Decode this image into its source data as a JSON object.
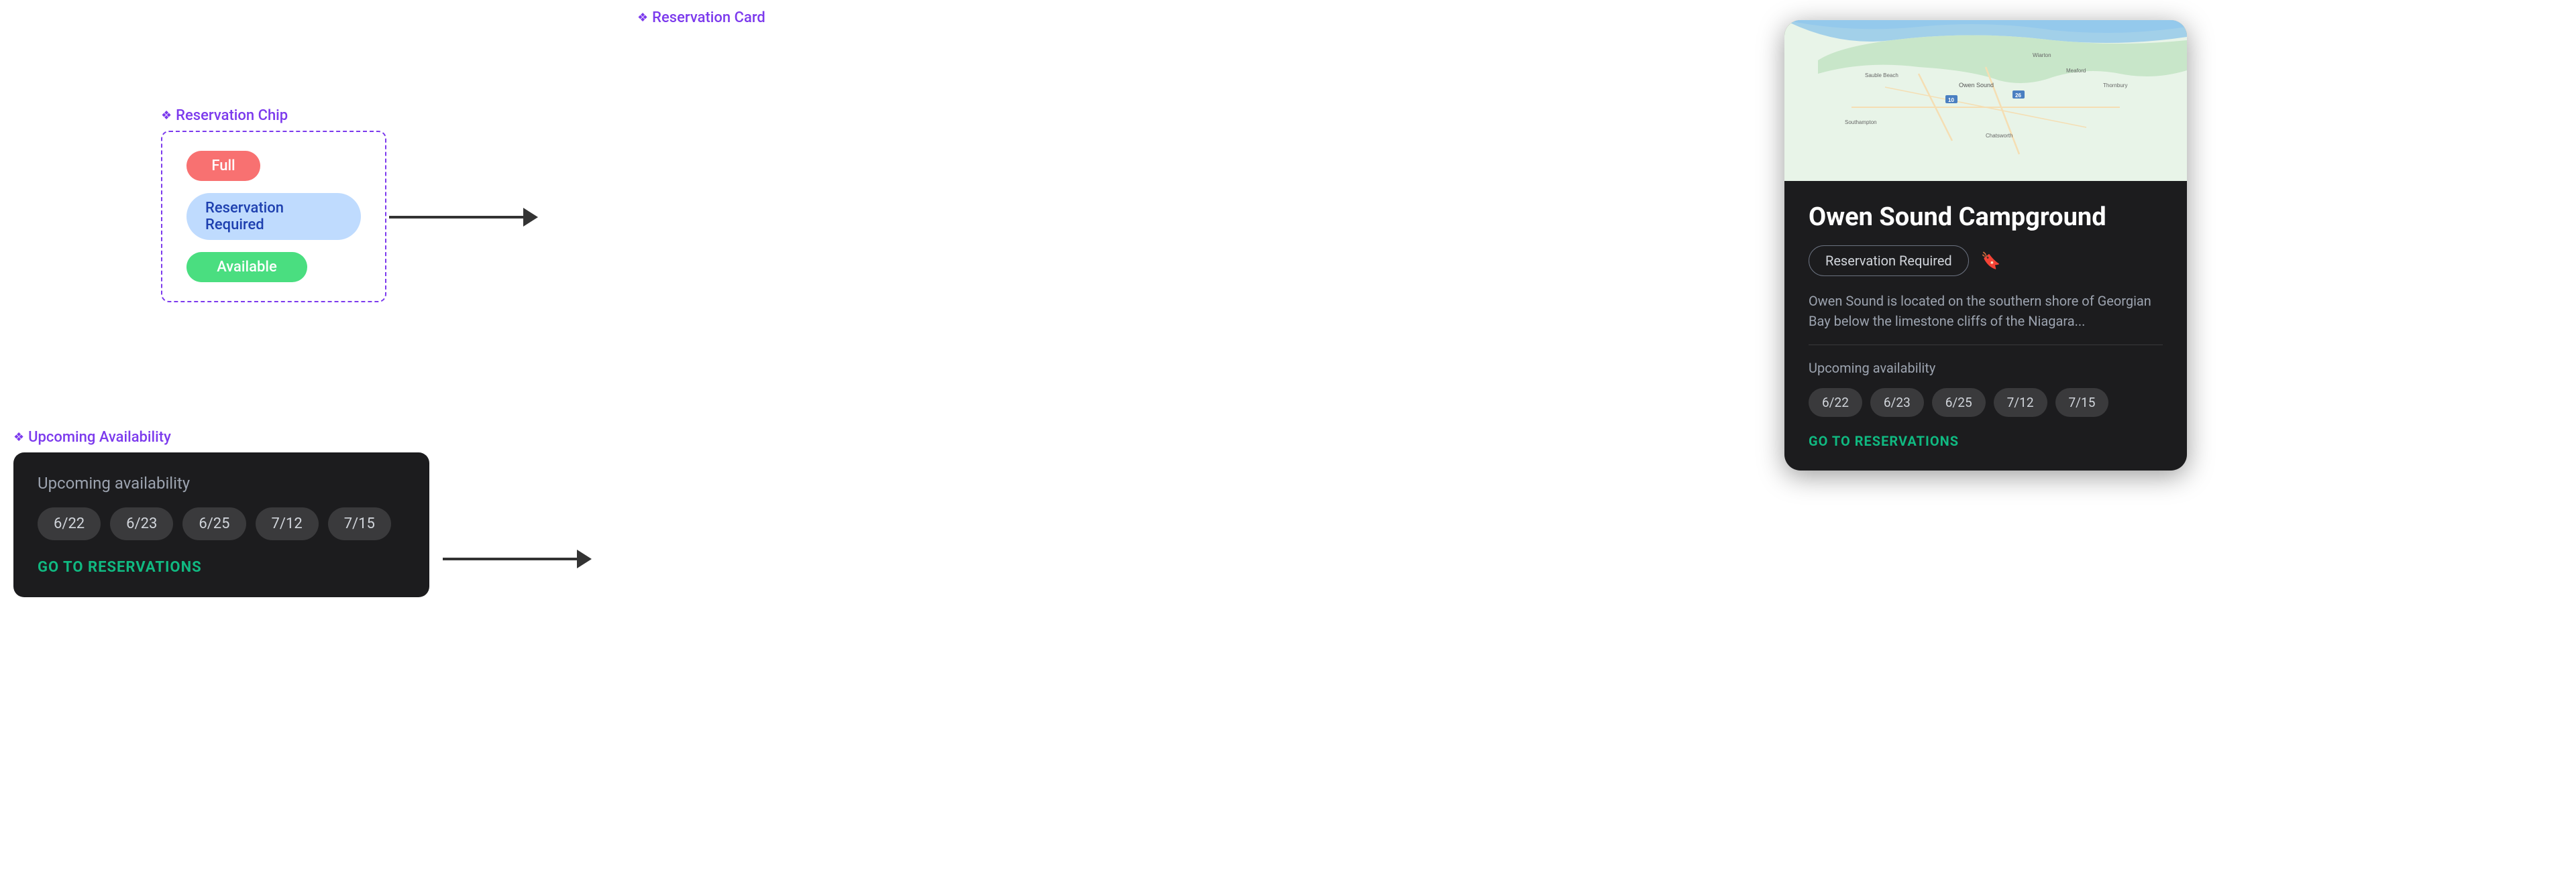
{
  "reservationChip": {
    "label": "Reservation Chip",
    "chips": {
      "full": "Full",
      "reservationRequired": "Reservation Required",
      "available": "Available"
    }
  },
  "upcomingAvailability": {
    "label": "Upcoming Availability",
    "title": "Upcoming availability",
    "dates": [
      "6/22",
      "6/23",
      "6/25",
      "7/12",
      "7/15"
    ],
    "cta": "GO TO RESERVATIONS"
  },
  "reservationCard": {
    "label": "Reservation Card",
    "campgroundName": "Owen Sound Campground",
    "chipLabel": "Reservation Required",
    "description": "Owen Sound is located on the southern shore of Georgian Bay below the limestone cliffs of the Niagara...",
    "upcomingTitle": "Upcoming availability",
    "dates": [
      "6/22",
      "6/23",
      "6/25",
      "7/12",
      "7/15"
    ],
    "cta": "GO TO RESERVATIONS"
  },
  "arrows": {
    "topArrow": "→",
    "bottomArrow": "→"
  }
}
